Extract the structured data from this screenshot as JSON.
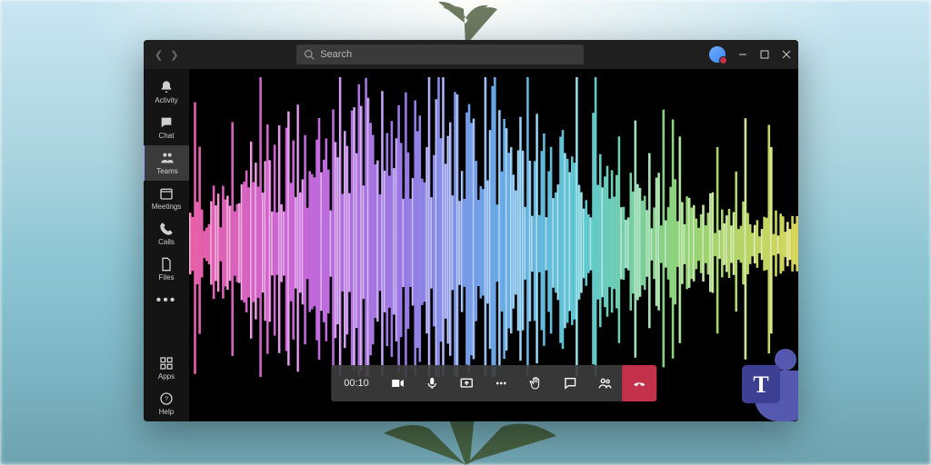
{
  "search": {
    "placeholder": "Search"
  },
  "rail": {
    "items": [
      {
        "id": "activity",
        "label": "Activity"
      },
      {
        "id": "chat",
        "label": "Chat"
      },
      {
        "id": "teams",
        "label": "Teams"
      },
      {
        "id": "meetings",
        "label": "Meetings"
      },
      {
        "id": "calls",
        "label": "Calls"
      },
      {
        "id": "files",
        "label": "Files"
      }
    ],
    "footer": [
      {
        "id": "apps",
        "label": "Apps"
      },
      {
        "id": "help",
        "label": "Help"
      }
    ],
    "active": "teams"
  },
  "call": {
    "timer": "00:10",
    "controls": [
      {
        "id": "camera",
        "icon": "video-icon"
      },
      {
        "id": "mic",
        "icon": "microphone-icon"
      },
      {
        "id": "share",
        "icon": "share-screen-icon"
      },
      {
        "id": "more",
        "icon": "more-icon"
      },
      {
        "id": "raise-hand",
        "icon": "raise-hand-icon"
      },
      {
        "id": "chat",
        "icon": "chat-icon"
      },
      {
        "id": "participants",
        "icon": "people-icon"
      },
      {
        "id": "hangup",
        "icon": "hangup-icon"
      }
    ]
  },
  "colors": {
    "rail_bg": "#141414",
    "titlebar_bg": "#1f1f1f",
    "hangup": "#c4314b",
    "teams_brand": "#5558af"
  }
}
